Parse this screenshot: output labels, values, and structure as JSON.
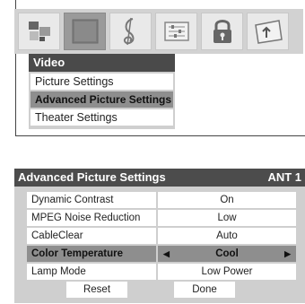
{
  "icon_bar": {
    "icons": [
      "picture-quality-icon",
      "video-icon",
      "audio-icon",
      "setup-icon",
      "lock-icon",
      "applications-icon"
    ],
    "selected_index": 1
  },
  "video_menu": {
    "title": "Video",
    "items": [
      {
        "label": "Picture Settings",
        "active": false
      },
      {
        "label": "Advanced Picture Settings",
        "active": true
      },
      {
        "label": "Theater Settings",
        "active": false
      }
    ]
  },
  "advanced": {
    "title": "Advanced Picture Settings",
    "source": "ANT 1",
    "rows": [
      {
        "label": "Dynamic Contrast",
        "value": "On"
      },
      {
        "label": "MPEG Noise Reduction",
        "value": "Low"
      },
      {
        "label": "CableClear",
        "value": "Auto"
      },
      {
        "label": "Color Temperature",
        "value": "Cool"
      },
      {
        "label": "Lamp Mode",
        "value": "Low Power"
      }
    ],
    "selected_row": 3,
    "buttons": {
      "reset": "Reset",
      "done": "Done"
    }
  },
  "colors": {
    "header_bg": "#4a4a4a",
    "panel_bg": "#cfcfcf",
    "selected_bg": "#8e8e8e",
    "icon_bar_bg": "#d2d2d2"
  }
}
